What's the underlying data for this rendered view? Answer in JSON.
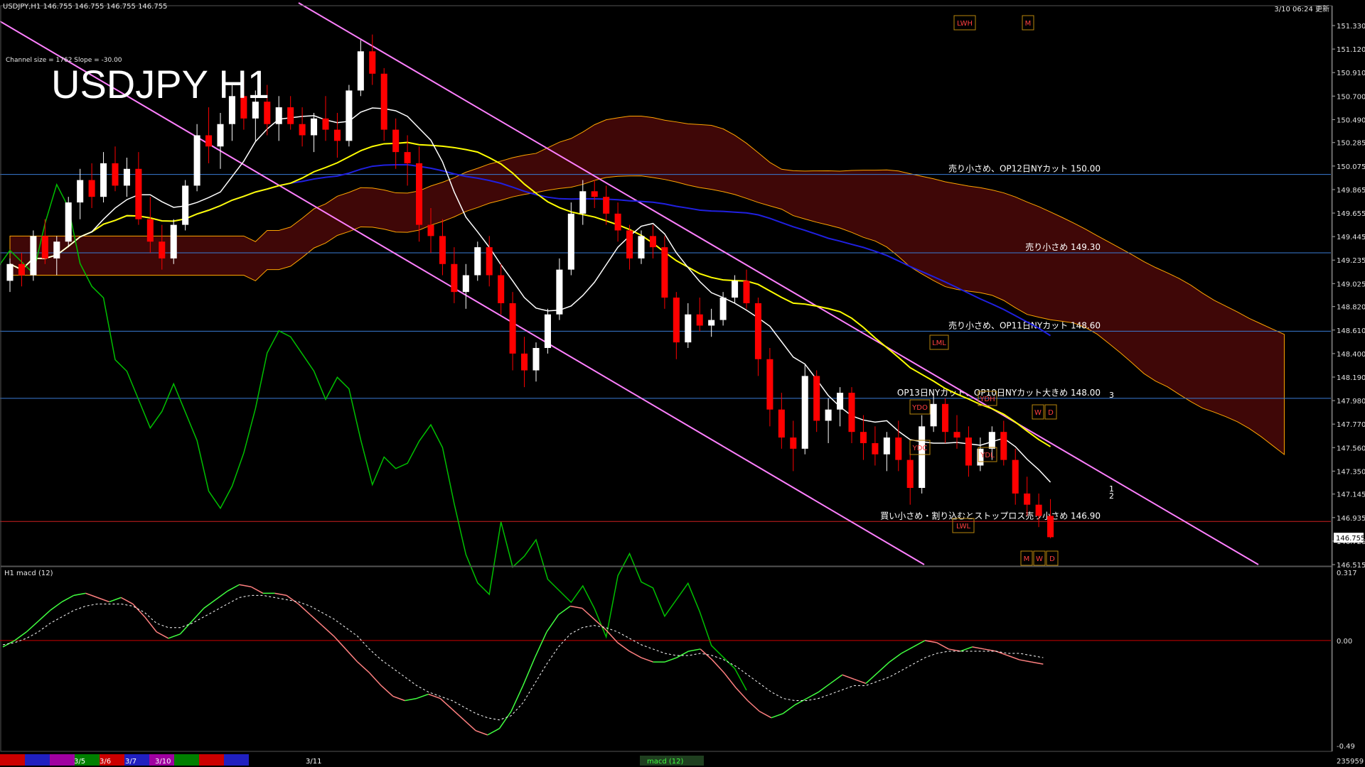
{
  "window": {
    "symbol_info": "USDJPY,H1  146.755 146.755 146.755 146.755",
    "timestamp": "3/10 06:24 更新",
    "channel_info": "Channel size = 1762 Slope = -30.00",
    "big_title": "USDJPY H1"
  },
  "colors": {
    "background": "#000000",
    "candle_up": "#ffffff",
    "candle_down": "#ff0000",
    "ma_fast": "#ffffff",
    "ma_mid": "#ffff00",
    "ma_slow": "#2020e0",
    "channel": "#ff80ff",
    "level_line": "#3a7bd5",
    "lagging_span": "#00c000",
    "cloud_edge": "#ffa500",
    "bollinger": "#cc0000",
    "macd_main_up": "#40ff40",
    "macd_main_down": "#ff8080",
    "macd_signal": "#ffffff",
    "zero_line": "#cc0000"
  },
  "chart_data": [
    {
      "type": "candlestick",
      "title": "USDJPY H1",
      "ylim": [
        146.515,
        151.33
      ],
      "y_ticks": [
        "151.330",
        "151.120",
        "150.910",
        "150.700",
        "150.490",
        "150.285",
        "150.075",
        "149.865",
        "149.655",
        "149.445",
        "149.235",
        "149.025",
        "148.820",
        "148.610",
        "148.400",
        "148.190",
        "147.980",
        "147.770",
        "147.560",
        "147.350",
        "147.145",
        "146.935",
        "146.725",
        "146.515"
      ],
      "current_price_label": "146.755",
      "candles": [
        [
          149.05,
          149.25,
          148.95,
          149.2
        ],
        [
          149.2,
          149.3,
          149.0,
          149.1
        ],
        [
          149.1,
          149.5,
          149.05,
          149.45
        ],
        [
          149.45,
          149.6,
          149.2,
          149.25
        ],
        [
          149.25,
          149.45,
          149.1,
          149.4
        ],
        [
          149.4,
          149.8,
          149.35,
          149.75
        ],
        [
          149.75,
          150.05,
          149.6,
          149.95
        ],
        [
          149.95,
          150.1,
          149.7,
          149.8
        ],
        [
          149.8,
          150.2,
          149.75,
          150.1
        ],
        [
          150.1,
          150.25,
          149.85,
          149.9
        ],
        [
          149.9,
          150.15,
          149.8,
          150.05
        ],
        [
          150.05,
          150.2,
          149.55,
          149.6
        ],
        [
          149.6,
          149.8,
          149.3,
          149.4
        ],
        [
          149.4,
          149.55,
          149.15,
          149.25
        ],
        [
          149.25,
          149.6,
          149.2,
          149.55
        ],
        [
          149.55,
          149.95,
          149.5,
          149.9
        ],
        [
          149.9,
          150.45,
          149.85,
          150.35
        ],
        [
          150.35,
          150.6,
          150.1,
          150.25
        ],
        [
          150.25,
          150.55,
          150.05,
          150.45
        ],
        [
          150.45,
          150.8,
          150.3,
          150.7
        ],
        [
          150.7,
          150.85,
          150.4,
          150.5
        ],
        [
          150.5,
          150.75,
          150.3,
          150.65
        ],
        [
          150.65,
          150.8,
          150.35,
          150.45
        ],
        [
          150.45,
          150.7,
          150.3,
          150.6
        ],
        [
          150.6,
          150.7,
          150.4,
          150.45
        ],
        [
          150.45,
          150.6,
          150.25,
          150.35
        ],
        [
          150.35,
          150.55,
          150.2,
          150.5
        ],
        [
          150.5,
          150.7,
          150.3,
          150.4
        ],
        [
          150.4,
          150.55,
          150.15,
          150.3
        ],
        [
          150.3,
          150.8,
          150.25,
          150.75
        ],
        [
          150.75,
          151.2,
          150.7,
          151.1
        ],
        [
          151.1,
          151.25,
          150.8,
          150.9
        ],
        [
          150.9,
          150.95,
          150.3,
          150.4
        ],
        [
          150.4,
          150.5,
          150.05,
          150.2
        ],
        [
          150.2,
          150.35,
          149.9,
          150.1
        ],
        [
          150.1,
          150.25,
          149.4,
          149.55
        ],
        [
          149.55,
          149.7,
          149.3,
          149.45
        ],
        [
          149.45,
          149.6,
          149.1,
          149.2
        ],
        [
          149.2,
          149.35,
          148.85,
          148.95
        ],
        [
          148.95,
          149.2,
          148.8,
          149.1
        ],
        [
          149.1,
          149.4,
          149.05,
          149.35
        ],
        [
          149.35,
          149.45,
          149.0,
          149.1
        ],
        [
          149.1,
          149.2,
          148.75,
          148.85
        ],
        [
          148.85,
          148.95,
          148.25,
          148.4
        ],
        [
          148.4,
          148.55,
          148.1,
          148.25
        ],
        [
          148.25,
          148.5,
          148.15,
          148.45
        ],
        [
          148.45,
          148.8,
          148.4,
          148.75
        ],
        [
          148.75,
          149.25,
          148.7,
          149.15
        ],
        [
          149.15,
          149.75,
          149.1,
          149.65
        ],
        [
          149.65,
          149.95,
          149.55,
          149.85
        ],
        [
          149.85,
          149.95,
          149.7,
          149.8
        ],
        [
          149.8,
          149.9,
          149.55,
          149.65
        ],
        [
          149.65,
          149.75,
          149.4,
          149.5
        ],
        [
          149.5,
          149.55,
          149.15,
          149.25
        ],
        [
          149.25,
          149.5,
          149.2,
          149.45
        ],
        [
          149.45,
          149.55,
          149.25,
          149.35
        ],
        [
          149.35,
          149.45,
          148.8,
          148.9
        ],
        [
          148.9,
          148.95,
          148.35,
          148.5
        ],
        [
          148.5,
          148.85,
          148.45,
          148.75
        ],
        [
          148.75,
          148.9,
          148.6,
          148.65
        ],
        [
          148.65,
          148.8,
          148.55,
          148.7
        ],
        [
          148.7,
          148.95,
          148.65,
          148.9
        ],
        [
          148.9,
          149.1,
          148.85,
          149.05
        ],
        [
          149.05,
          149.15,
          148.8,
          148.85
        ],
        [
          148.85,
          148.9,
          148.2,
          148.35
        ],
        [
          148.35,
          148.45,
          147.75,
          147.9
        ],
        [
          147.9,
          148.05,
          147.55,
          147.65
        ],
        [
          147.65,
          147.8,
          147.35,
          147.55
        ],
        [
          147.55,
          148.3,
          147.5,
          148.2
        ],
        [
          148.2,
          148.25,
          147.7,
          147.8
        ],
        [
          147.8,
          148.0,
          147.6,
          147.9
        ],
        [
          147.9,
          148.1,
          147.75,
          148.05
        ],
        [
          148.05,
          148.1,
          147.6,
          147.7
        ],
        [
          147.7,
          147.85,
          147.45,
          147.6
        ],
        [
          147.6,
          147.75,
          147.4,
          147.5
        ],
        [
          147.5,
          147.7,
          147.35,
          147.65
        ],
        [
          147.65,
          147.8,
          147.35,
          147.45
        ],
        [
          147.45,
          147.55,
          147.05,
          147.2
        ],
        [
          147.2,
          147.85,
          147.15,
          147.75
        ],
        [
          147.75,
          148.05,
          147.7,
          147.95
        ],
        [
          147.95,
          148.0,
          147.6,
          147.7
        ],
        [
          147.7,
          147.85,
          147.55,
          147.65
        ],
        [
          147.65,
          147.75,
          147.3,
          147.4
        ],
        [
          147.4,
          147.65,
          147.35,
          147.55
        ],
        [
          147.55,
          147.75,
          147.45,
          147.7
        ],
        [
          147.7,
          147.8,
          147.4,
          147.45
        ],
        [
          147.45,
          147.55,
          147.05,
          147.15
        ],
        [
          147.15,
          147.3,
          146.95,
          147.05
        ],
        [
          147.05,
          147.15,
          146.85,
          146.95
        ],
        [
          146.95,
          147.1,
          146.75,
          146.76
        ]
      ],
      "levels": [
        {
          "price": 150.0,
          "label": "売り小さめ、OP12日NYカット 150.00"
        },
        {
          "price": 149.3,
          "label": "売り小さめ 149.30"
        },
        {
          "price": 148.6,
          "label": "売り小さめ、OP11日NYカット 148.60"
        },
        {
          "price": 148.0,
          "label": "OP13日NYカット、OP10日NYカット大きめ 148.00"
        },
        {
          "price": 146.9,
          "label": "買い小さめ・割り込むとストップロス売り小さめ 146.90"
        }
      ],
      "boxes": [
        "LWH",
        "M",
        "LML",
        "YDO",
        "YDH",
        "W",
        "D",
        "YDC",
        "YDL",
        "LWL",
        "M",
        "W",
        "D"
      ],
      "projection_labels": [
        "3",
        "1",
        "2"
      ]
    },
    {
      "type": "line",
      "title": "H1  macd (12)",
      "ylim": [
        -0.49,
        0.317
      ],
      "y_ticks": [
        "0.317",
        "0.00",
        "-0.49"
      ],
      "series": [
        {
          "values": [
            -0.03,
            0.0,
            0.04,
            0.09,
            0.14,
            0.18,
            0.21,
            0.22,
            0.2,
            0.18,
            0.2,
            0.17,
            0.11,
            0.04,
            0.01,
            0.03,
            0.09,
            0.15,
            0.19,
            0.23,
            0.26,
            0.25,
            0.22,
            0.22,
            0.21,
            0.17,
            0.12,
            0.07,
            0.02,
            -0.04,
            -0.1,
            -0.15,
            -0.21,
            -0.26,
            -0.28,
            -0.27,
            -0.25,
            -0.27,
            -0.32,
            -0.37,
            -0.42,
            -0.44,
            -0.41,
            -0.33,
            -0.21,
            -0.08,
            0.04,
            0.12,
            0.16,
            0.15,
            0.1,
            0.05,
            -0.01,
            -0.05,
            -0.08,
            -0.1,
            -0.1,
            -0.08,
            -0.05,
            -0.04,
            -0.09,
            -0.15,
            -0.22,
            -0.28,
            -0.33,
            -0.36,
            -0.34,
            -0.3,
            -0.27,
            -0.24,
            -0.2,
            -0.16,
            -0.18,
            -0.2,
            -0.15,
            -0.1,
            -0.06,
            -0.03,
            0.0,
            -0.01,
            -0.04,
            -0.05,
            -0.03,
            -0.04,
            -0.05,
            -0.07,
            -0.09,
            -0.1,
            -0.11
          ]
        },
        {
          "values": [
            -0.02,
            -0.01,
            0.01,
            0.04,
            0.08,
            0.11,
            0.14,
            0.16,
            0.17,
            0.17,
            0.17,
            0.16,
            0.13,
            0.08,
            0.06,
            0.06,
            0.08,
            0.11,
            0.14,
            0.17,
            0.2,
            0.21,
            0.21,
            0.2,
            0.19,
            0.18,
            0.16,
            0.13,
            0.1,
            0.06,
            0.02,
            -0.04,
            -0.09,
            -0.13,
            -0.17,
            -0.21,
            -0.24,
            -0.26,
            -0.28,
            -0.31,
            -0.34,
            -0.36,
            -0.37,
            -0.35,
            -0.29,
            -0.2,
            -0.11,
            -0.03,
            0.03,
            0.06,
            0.07,
            0.06,
            0.04,
            0.01,
            -0.02,
            -0.04,
            -0.06,
            -0.07,
            -0.07,
            -0.06,
            -0.07,
            -0.09,
            -0.12,
            -0.16,
            -0.2,
            -0.24,
            -0.27,
            -0.28,
            -0.28,
            -0.27,
            -0.25,
            -0.23,
            -0.21,
            -0.21,
            -0.19,
            -0.17,
            -0.14,
            -0.11,
            -0.08,
            -0.06,
            -0.05,
            -0.05,
            -0.05,
            -0.05,
            -0.05,
            -0.06,
            -0.06,
            -0.07,
            -0.08
          ]
        }
      ]
    }
  ],
  "bottom_bar": {
    "date_labels": [
      "3/5",
      "3/6",
      "3/7",
      "3/10",
      "3/11"
    ],
    "tab_label": "macd (12)",
    "count_label": "235959"
  }
}
